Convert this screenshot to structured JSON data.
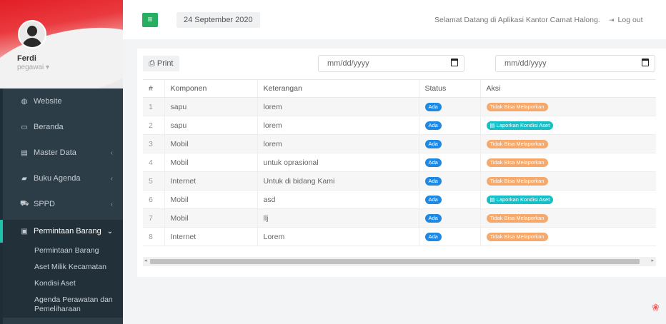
{
  "sidebar": {
    "user_name": "Ferdi",
    "user_role": "pegawai ▾",
    "nav": [
      {
        "label": "Website",
        "icon": "globe-icon",
        "glyph": "◍",
        "chev": ""
      },
      {
        "label": "Beranda",
        "icon": "laptop-icon",
        "glyph": "▭",
        "chev": ""
      },
      {
        "label": "Master Data",
        "icon": "database-icon",
        "glyph": "▤",
        "chev": "‹"
      },
      {
        "label": "Buku Agenda",
        "icon": "book-icon",
        "glyph": "▰",
        "chev": "‹"
      },
      {
        "label": "SPPD",
        "icon": "car-icon",
        "glyph": "⛟",
        "chev": "‹"
      }
    ],
    "active": {
      "label": "Permintaan Barang",
      "icon": "money-icon",
      "glyph": "▣",
      "chev": "⌄"
    },
    "subitems": [
      "Permintaan Barang",
      "Aset Milik Kecamatan",
      "Kondisi Aset",
      "Agenda Perawatan dan Pemeliharaan"
    ]
  },
  "header": {
    "toggle_glyph": "≡",
    "date": "24 September 2020",
    "welcome": "Selamat Datang di Aplikasi Kantor Camat Halong.",
    "logout": "Log out",
    "logout_glyph": "⇥"
  },
  "toolbar": {
    "print_label": "Print",
    "print_glyph": "⎙",
    "date_from_placeholder": "mm/dd/yyyy",
    "date_to_placeholder": "mm/dd/yyyy"
  },
  "table": {
    "headers": [
      "#",
      "Komponen",
      "Keterangan",
      "Status",
      "Aksi"
    ],
    "rows": [
      {
        "no": "1",
        "komponen": "sapu",
        "keterangan": "lorem",
        "status": "Ada",
        "aksi": "Tidak Bisa Melaporkan",
        "aksi_type": "cannot"
      },
      {
        "no": "2",
        "komponen": "sapu",
        "keterangan": "lorem",
        "status": "Ada",
        "aksi": "Laporkan Kondisi Aset",
        "aksi_type": "report"
      },
      {
        "no": "3",
        "komponen": "Mobil",
        "keterangan": "lorem",
        "status": "Ada",
        "aksi": "Tidak Bisa Melaporkan",
        "aksi_type": "cannot"
      },
      {
        "no": "4",
        "komponen": "Mobil",
        "keterangan": "untuk oprasional",
        "status": "Ada",
        "aksi": "Tidak Bisa Melaporkan",
        "aksi_type": "cannot"
      },
      {
        "no": "5",
        "komponen": "Internet",
        "keterangan": "Untuk di bidang Kami",
        "status": "Ada",
        "aksi": "Tidak Bisa Melaporkan",
        "aksi_type": "cannot"
      },
      {
        "no": "6",
        "komponen": "Mobil",
        "keterangan": "asd",
        "status": "Ada",
        "aksi": "Laporkan Kondisi Aset",
        "aksi_type": "report"
      },
      {
        "no": "7",
        "komponen": "Mobil",
        "keterangan": "llj",
        "status": "Ada",
        "aksi": "Tidak Bisa Melaporkan",
        "aksi_type": "cannot"
      },
      {
        "no": "8",
        "komponen": "Internet",
        "keterangan": "Lorem",
        "status": "Ada",
        "aksi": "Tidak Bisa Melaporkan",
        "aksi_type": "cannot"
      }
    ]
  },
  "colors": {
    "accent": "#27ae60",
    "sidebar": "#2d3d48",
    "status_badge": "#1e88e5",
    "cannot_badge": "#f6a96b",
    "report_badge": "#16c0c9"
  }
}
